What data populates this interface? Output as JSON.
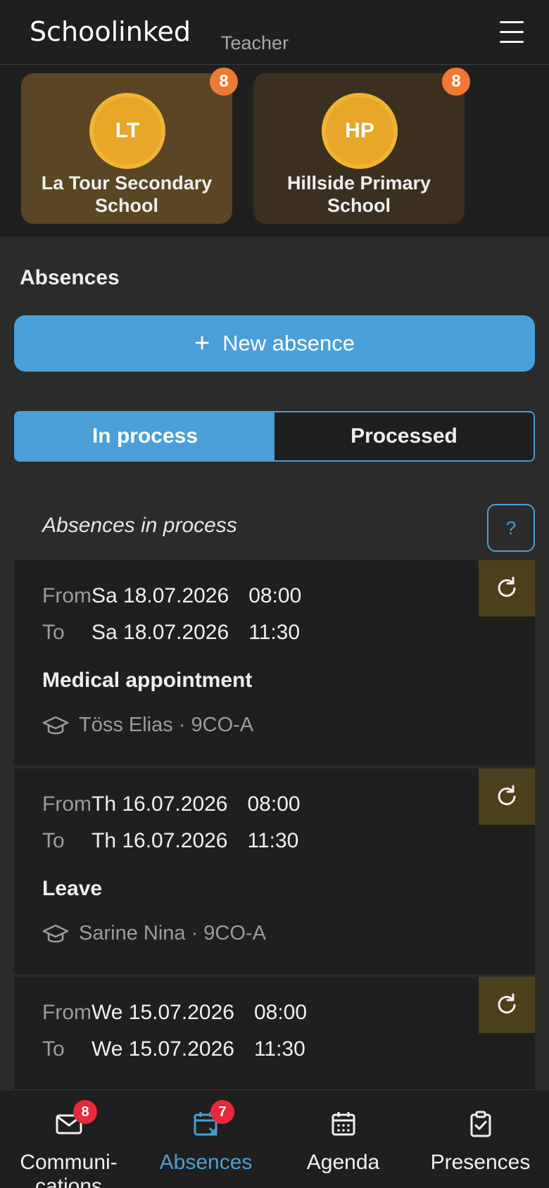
{
  "header": {
    "logo_text": "Schoolinked",
    "role": "Teacher",
    "menu_icon": "hamburger-menu-icon"
  },
  "schools": [
    {
      "initials": "LT",
      "name": "La Tour Secondary School",
      "badge": "8"
    },
    {
      "initials": "HP",
      "name": "Hillside Primary School",
      "badge": "8"
    }
  ],
  "absences": {
    "section_title": "Absences",
    "new_button_icon": "plus-icon",
    "new_button_label": "New absence",
    "tabs": [
      {
        "label": "In process",
        "active": true
      },
      {
        "label": "Processed",
        "active": false
      }
    ],
    "list_title": "Absences in process",
    "help_label": "?",
    "items": [
      {
        "from_label": "From",
        "from_date": "Sa 18.07.2026",
        "from_time": "08:00",
        "to_label": "To",
        "to_date": "Sa 18.07.2026",
        "to_time": "11:30",
        "reason": "Medical appointment",
        "student": "Töss Elias · 9CO-A"
      },
      {
        "from_label": "From",
        "from_date": "Th 16.07.2026",
        "from_time": "08:00",
        "to_label": "To",
        "to_date": "Th 16.07.2026",
        "to_time": "11:30",
        "reason": "Leave",
        "student": "Sarine Nina · 9CO-A"
      },
      {
        "from_label": "From",
        "from_date": "We 15.07.2026",
        "from_time": "08:00",
        "to_label": "To",
        "to_date": "We 15.07.2026",
        "to_time": "11:30",
        "reason": "",
        "student": ""
      }
    ]
  },
  "bottom_nav": [
    {
      "label_line1": "Communi-",
      "label_line2": "cations",
      "icon": "envelope-icon",
      "badge": "8",
      "active": false
    },
    {
      "label_line1": "Absences",
      "label_line2": "",
      "icon": "calendar-x-icon",
      "badge": "7",
      "active": true
    },
    {
      "label_line1": "Agenda",
      "label_line2": "",
      "icon": "calendar-icon",
      "badge": "",
      "active": false
    },
    {
      "label_line1": "Presences",
      "label_line2": "",
      "icon": "clipboard-check-icon",
      "badge": "",
      "active": false
    }
  ],
  "colors": {
    "accent": "#4a9fd6",
    "badge_orange": "#ee7a35",
    "badge_red": "#e8293b",
    "school_gold": "#e8a729"
  }
}
